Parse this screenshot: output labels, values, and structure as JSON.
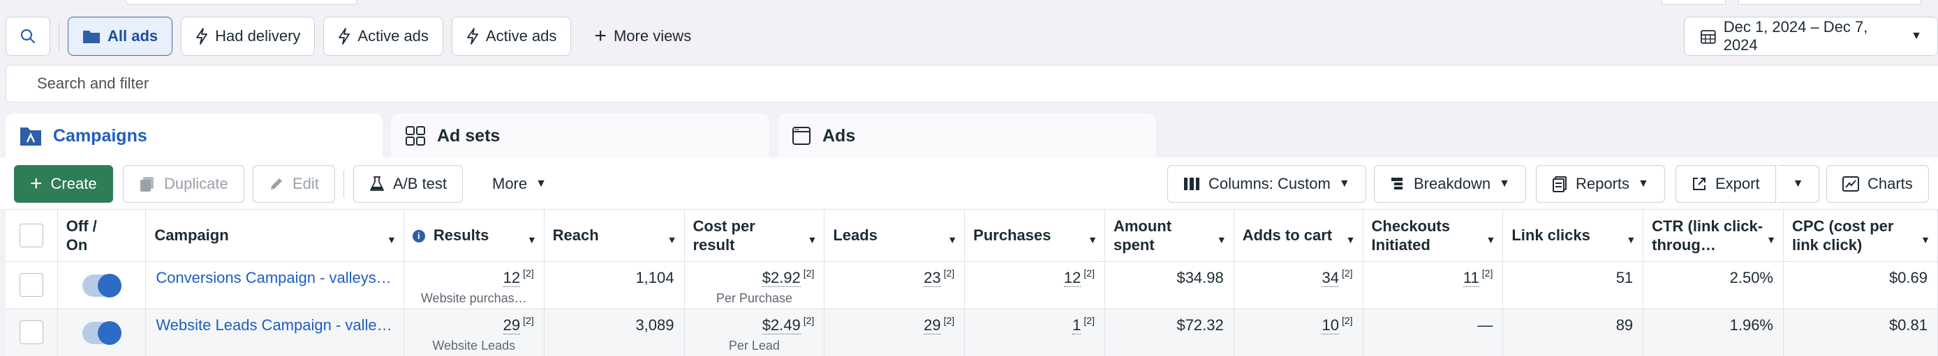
{
  "toolbar": {
    "views": [
      "All ads",
      "Had delivery",
      "Active ads",
      "Active ads"
    ],
    "more_views": "More views",
    "date_range": "Dec 1, 2024 – Dec 7, 2024"
  },
  "search": {
    "placeholder": "Search and filter"
  },
  "level_tabs": {
    "campaigns": "Campaigns",
    "adsets": "Ad sets",
    "ads": "Ads"
  },
  "actions": {
    "create": "Create",
    "duplicate": "Duplicate",
    "edit": "Edit",
    "ab_test": "A/B test",
    "more": "More",
    "columns": "Columns: Custom",
    "breakdown": "Breakdown",
    "reports": "Reports",
    "export": "Export",
    "charts": "Charts"
  },
  "table": {
    "headers": {
      "offon": "Off / On",
      "campaign": "Campaign",
      "results": "Results",
      "reach": "Reach",
      "cost_per_result": "Cost per result",
      "leads": "Leads",
      "purchases": "Purchases",
      "amount_spent": "Amount spent",
      "adds_to_cart": "Adds to cart",
      "checkouts": "Checkouts Initiated",
      "link_clicks": "Link clicks",
      "ctr": "CTR (link click-throug…",
      "cpc": "CPC (cost per link click)"
    },
    "ref": "[2]",
    "rows": [
      {
        "campaign": "Conversions Campaign - valleys…",
        "results": "12",
        "results_sub": "Website purchas…",
        "reach": "1,104",
        "cost": "$2.92",
        "cost_sub": "Per Purchase",
        "leads": "23",
        "purchases": "12",
        "amount": "$34.98",
        "adds": "34",
        "checkouts": "11",
        "link_clicks": "51",
        "ctr": "2.50%",
        "cpc": "$0.69",
        "enabled": true
      },
      {
        "campaign": "Website Leads Campaign - valle…",
        "results": "29",
        "results_sub": "Website Leads",
        "reach": "3,089",
        "cost": "$2.49",
        "cost_sub": "Per Lead",
        "leads": "29",
        "purchases": "1",
        "amount": "$72.32",
        "adds": "10",
        "checkouts": "—",
        "link_clicks": "89",
        "ctr": "1.96%",
        "cpc": "$0.81",
        "enabled": true
      }
    ]
  },
  "colors": {
    "accent": "#1d5fc0",
    "create_green": "#2e7d56",
    "toggle_on": "#2e6bc4"
  }
}
